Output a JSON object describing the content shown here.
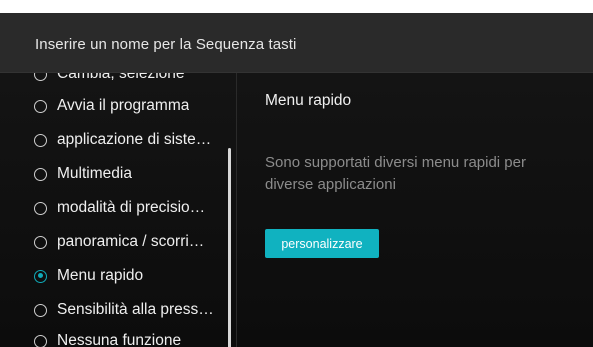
{
  "header": {
    "title": "Inserire un nome per la Sequenza tasti"
  },
  "sidebar": {
    "options": [
      {
        "label": "Cambia, selezione",
        "checked": false
      },
      {
        "label": "Avvia il programma",
        "checked": false
      },
      {
        "label": "applicazione di siste…",
        "checked": false
      },
      {
        "label": "Multimedia",
        "checked": false
      },
      {
        "label": "modalità di precisio…",
        "checked": false
      },
      {
        "label": "panoramica / scorri…",
        "checked": false
      },
      {
        "label": "Menu rapido",
        "checked": true
      },
      {
        "label": "Sensibilità alla press…",
        "checked": false
      },
      {
        "label": "Nessuna funzione",
        "checked": false
      }
    ]
  },
  "content": {
    "title": "Menu rapido",
    "description": "Sono supportati diversi menu rapidi per diverse applicazioni",
    "button_label": "personalizzare"
  },
  "colors": {
    "accent": "#10b2c0",
    "background": "#0c0c0c",
    "header": "#2a2a2a"
  }
}
